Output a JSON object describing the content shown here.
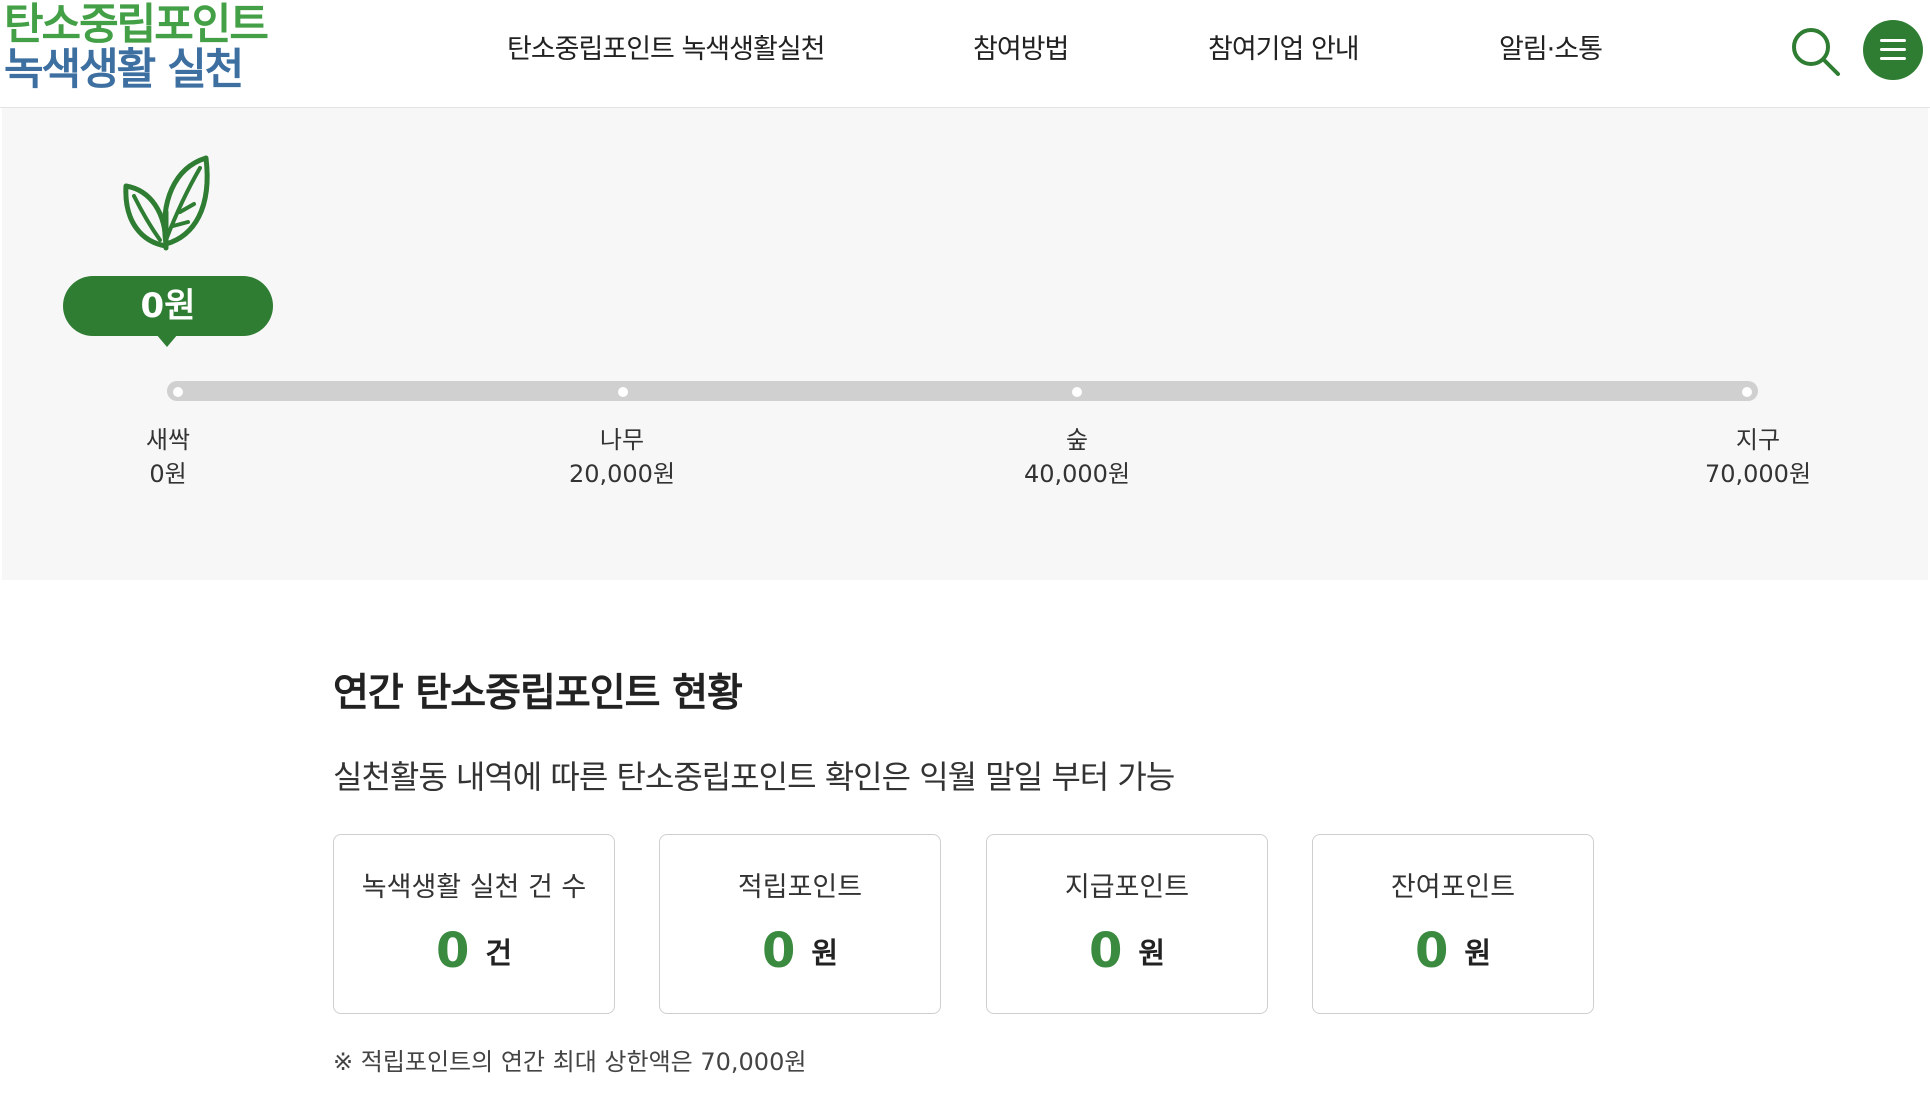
{
  "header": {
    "logo_line1": "탄소중립포인트",
    "logo_line2": "녹색생활 실천",
    "nav": [
      {
        "label": "탄소중립포인트 녹색생활실천"
      },
      {
        "label": "참여방법"
      },
      {
        "label": "참여기업 안내"
      },
      {
        "label": "알림·소통"
      }
    ],
    "icons": {
      "search": "search-icon",
      "menu": "hamburger-menu-icon"
    }
  },
  "level": {
    "icon": "leaf-icon",
    "current_amount": "0원",
    "progress_fraction": 0,
    "levels": [
      {
        "name": "새싹",
        "amount": "0원",
        "threshold": 0
      },
      {
        "name": "나무",
        "amount": "20,000원",
        "threshold": 20000
      },
      {
        "name": "숲",
        "amount": "40,000원",
        "threshold": 40000
      },
      {
        "name": "지구",
        "amount": "70,000원",
        "threshold": 70000
      }
    ]
  },
  "annual": {
    "title": "연간 탄소중립포인트 현황",
    "description": "실천활동 내역에 따른 탄소중립포인트 확인은 익월 말일 부터 가능",
    "cards": [
      {
        "label": "녹색생활 실천 건 수",
        "value": "0",
        "unit": "건"
      },
      {
        "label": "적립포인트",
        "value": "0",
        "unit": "원"
      },
      {
        "label": "지급포인트",
        "value": "0",
        "unit": "원"
      },
      {
        "label": "잔여포인트",
        "value": "0",
        "unit": "원"
      }
    ],
    "footnote": "※ 적립포인트의 연간 최대 상한액은 70,000원"
  },
  "colors": {
    "brand_green": "#2e7d32",
    "logo_green": "#43a047",
    "logo_blue": "#3d6fa1",
    "value_green": "#3a8a3f",
    "band_bg": "#f7f7f7",
    "track": "#d0d0d0"
  }
}
